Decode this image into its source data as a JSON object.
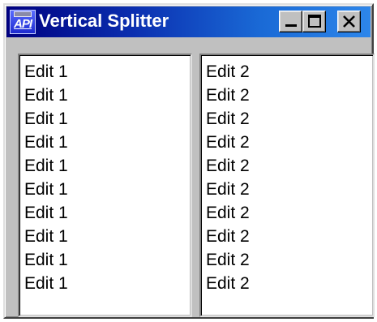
{
  "window": {
    "title": "Vertical Splitter",
    "icon_label": "API",
    "caption_buttons": [
      "minimize-icon",
      "maximize-icon",
      "close-icon"
    ]
  },
  "left_pane": {
    "lines": [
      "Edit 1",
      "Edit 1",
      "Edit 1",
      "Edit 1",
      "Edit 1",
      "Edit 1",
      "Edit 1",
      "Edit 1",
      "Edit 1",
      "Edit 1"
    ]
  },
  "right_pane": {
    "lines": [
      "Edit 2",
      "Edit 2",
      "Edit 2",
      "Edit 2",
      "Edit 2",
      "Edit 2",
      "Edit 2",
      "Edit 2",
      "Edit 2",
      "Edit 2"
    ]
  },
  "colors": {
    "titlebar_start": "#000080",
    "titlebar_end": "#2d86ea",
    "face": "#c0c0c0"
  }
}
